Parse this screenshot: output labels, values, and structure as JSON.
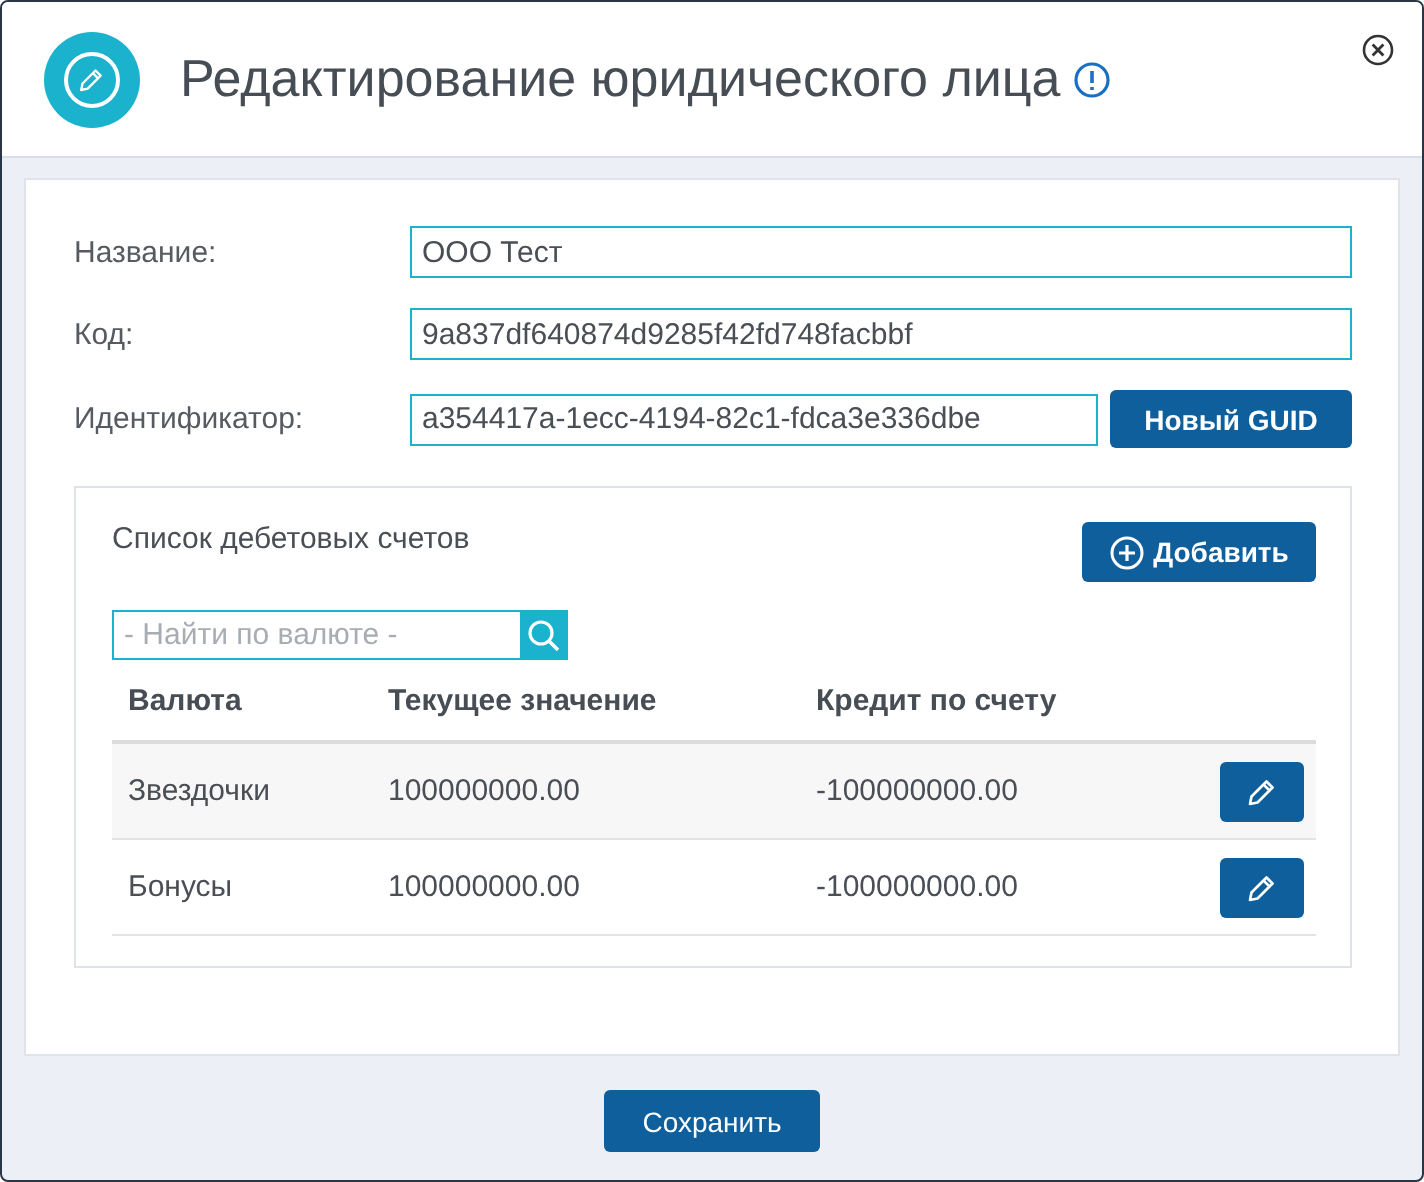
{
  "dialog": {
    "title": "Редактирование юридического лица"
  },
  "fields": [
    {
      "label": "Название:",
      "value": "ООО Тест"
    },
    {
      "label": "Код:",
      "value": "9a837df640874d9285f42fd748facbbf"
    },
    {
      "label": "Идентификатор:",
      "value": "a354417a-1ecc-4194-82c1-fdca3e336dbe",
      "button": "Новый GUID"
    }
  ],
  "accounts": {
    "title": "Список дебетовых счетов",
    "add_button": "Добавить",
    "search": {
      "placeholder": "- Найти по валюте -"
    },
    "columns": [
      "Валюта",
      "Текущее значение",
      "Кредит по счету"
    ],
    "rows": [
      {
        "cells": [
          "Звездочки",
          "100000000.00",
          "-100000000.00"
        ]
      },
      {
        "cells": [
          "Бонусы",
          "100000000.00",
          "-100000000.00"
        ]
      }
    ]
  },
  "save_button": "Сохранить"
}
